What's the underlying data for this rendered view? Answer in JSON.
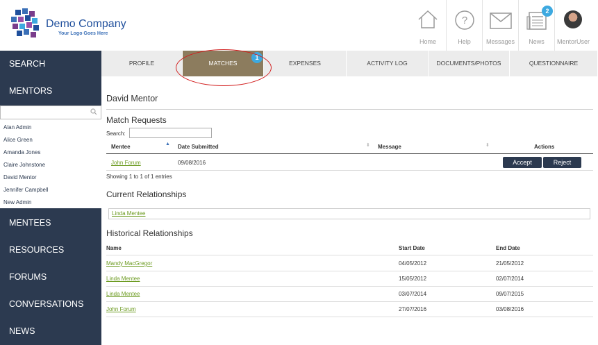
{
  "brand": {
    "name": "Demo Company",
    "tagline": "Your Logo Goes Here"
  },
  "header_icons": [
    {
      "label": "Home",
      "icon": "home-icon"
    },
    {
      "label": "Help",
      "icon": "help-icon"
    },
    {
      "label": "Messages",
      "icon": "envelope-icon"
    },
    {
      "label": "News",
      "icon": "news-icon",
      "badge": "2"
    },
    {
      "label": "MentorUser",
      "icon": "avatar"
    }
  ],
  "sidebar": {
    "top_items": [
      "SEARCH",
      "MENTORS"
    ],
    "mentor_search_placeholder": "",
    "mentors": [
      "Alan Admin",
      "Alice Green",
      "Amanda Jones",
      "Claire Johnstone",
      "David Mentor",
      "Jennifer Campbell",
      "New Admin"
    ],
    "bottom_items": [
      "MENTEES",
      "RESOURCES",
      "FORUMS",
      "CONVERSATIONS",
      "NEWS"
    ]
  },
  "tabs": [
    {
      "label": "PROFILE"
    },
    {
      "label": "MATCHES",
      "badge": "1"
    },
    {
      "label": "EXPENSES"
    },
    {
      "label": "ACTIVITY LOG"
    },
    {
      "label": "DOCUMENTS/PHOTOS"
    },
    {
      "label": "QUESTIONNAIRE"
    }
  ],
  "page_title": "David Mentor",
  "match_requests": {
    "heading": "Match Requests",
    "search_label": "Search:",
    "columns": [
      "Mentee",
      "Date Submitted",
      "Message",
      "Actions"
    ],
    "rows": [
      {
        "mentee": "John Forum",
        "date": "09/08/2016",
        "message": "",
        "accept": "Accept",
        "reject": "Reject"
      }
    ],
    "info": "Showing 1 to 1 of 1 entries"
  },
  "current": {
    "heading": "Current Relationships",
    "items": [
      "Linda Mentee"
    ]
  },
  "historical": {
    "heading": "Historical Relationships",
    "columns": [
      "Name",
      "Start Date",
      "End Date"
    ],
    "rows": [
      {
        "name": "Mandy MacGregor",
        "start": "04/05/2012",
        "end": "21/05/2012"
      },
      {
        "name": "Linda Mentee",
        "start": "15/05/2012",
        "end": "02/07/2014"
      },
      {
        "name": "Linda Mentee",
        "start": "03/07/2014",
        "end": "09/07/2015"
      },
      {
        "name": "John Forum",
        "start": "27/07/2016",
        "end": "03/08/2016"
      }
    ]
  },
  "colors": {
    "sidebar": "#2c3a50",
    "active_tab": "#8c7c5e",
    "link": "#6b9a1f",
    "badge": "#3da9e0",
    "highlight": "#d21e1e"
  }
}
